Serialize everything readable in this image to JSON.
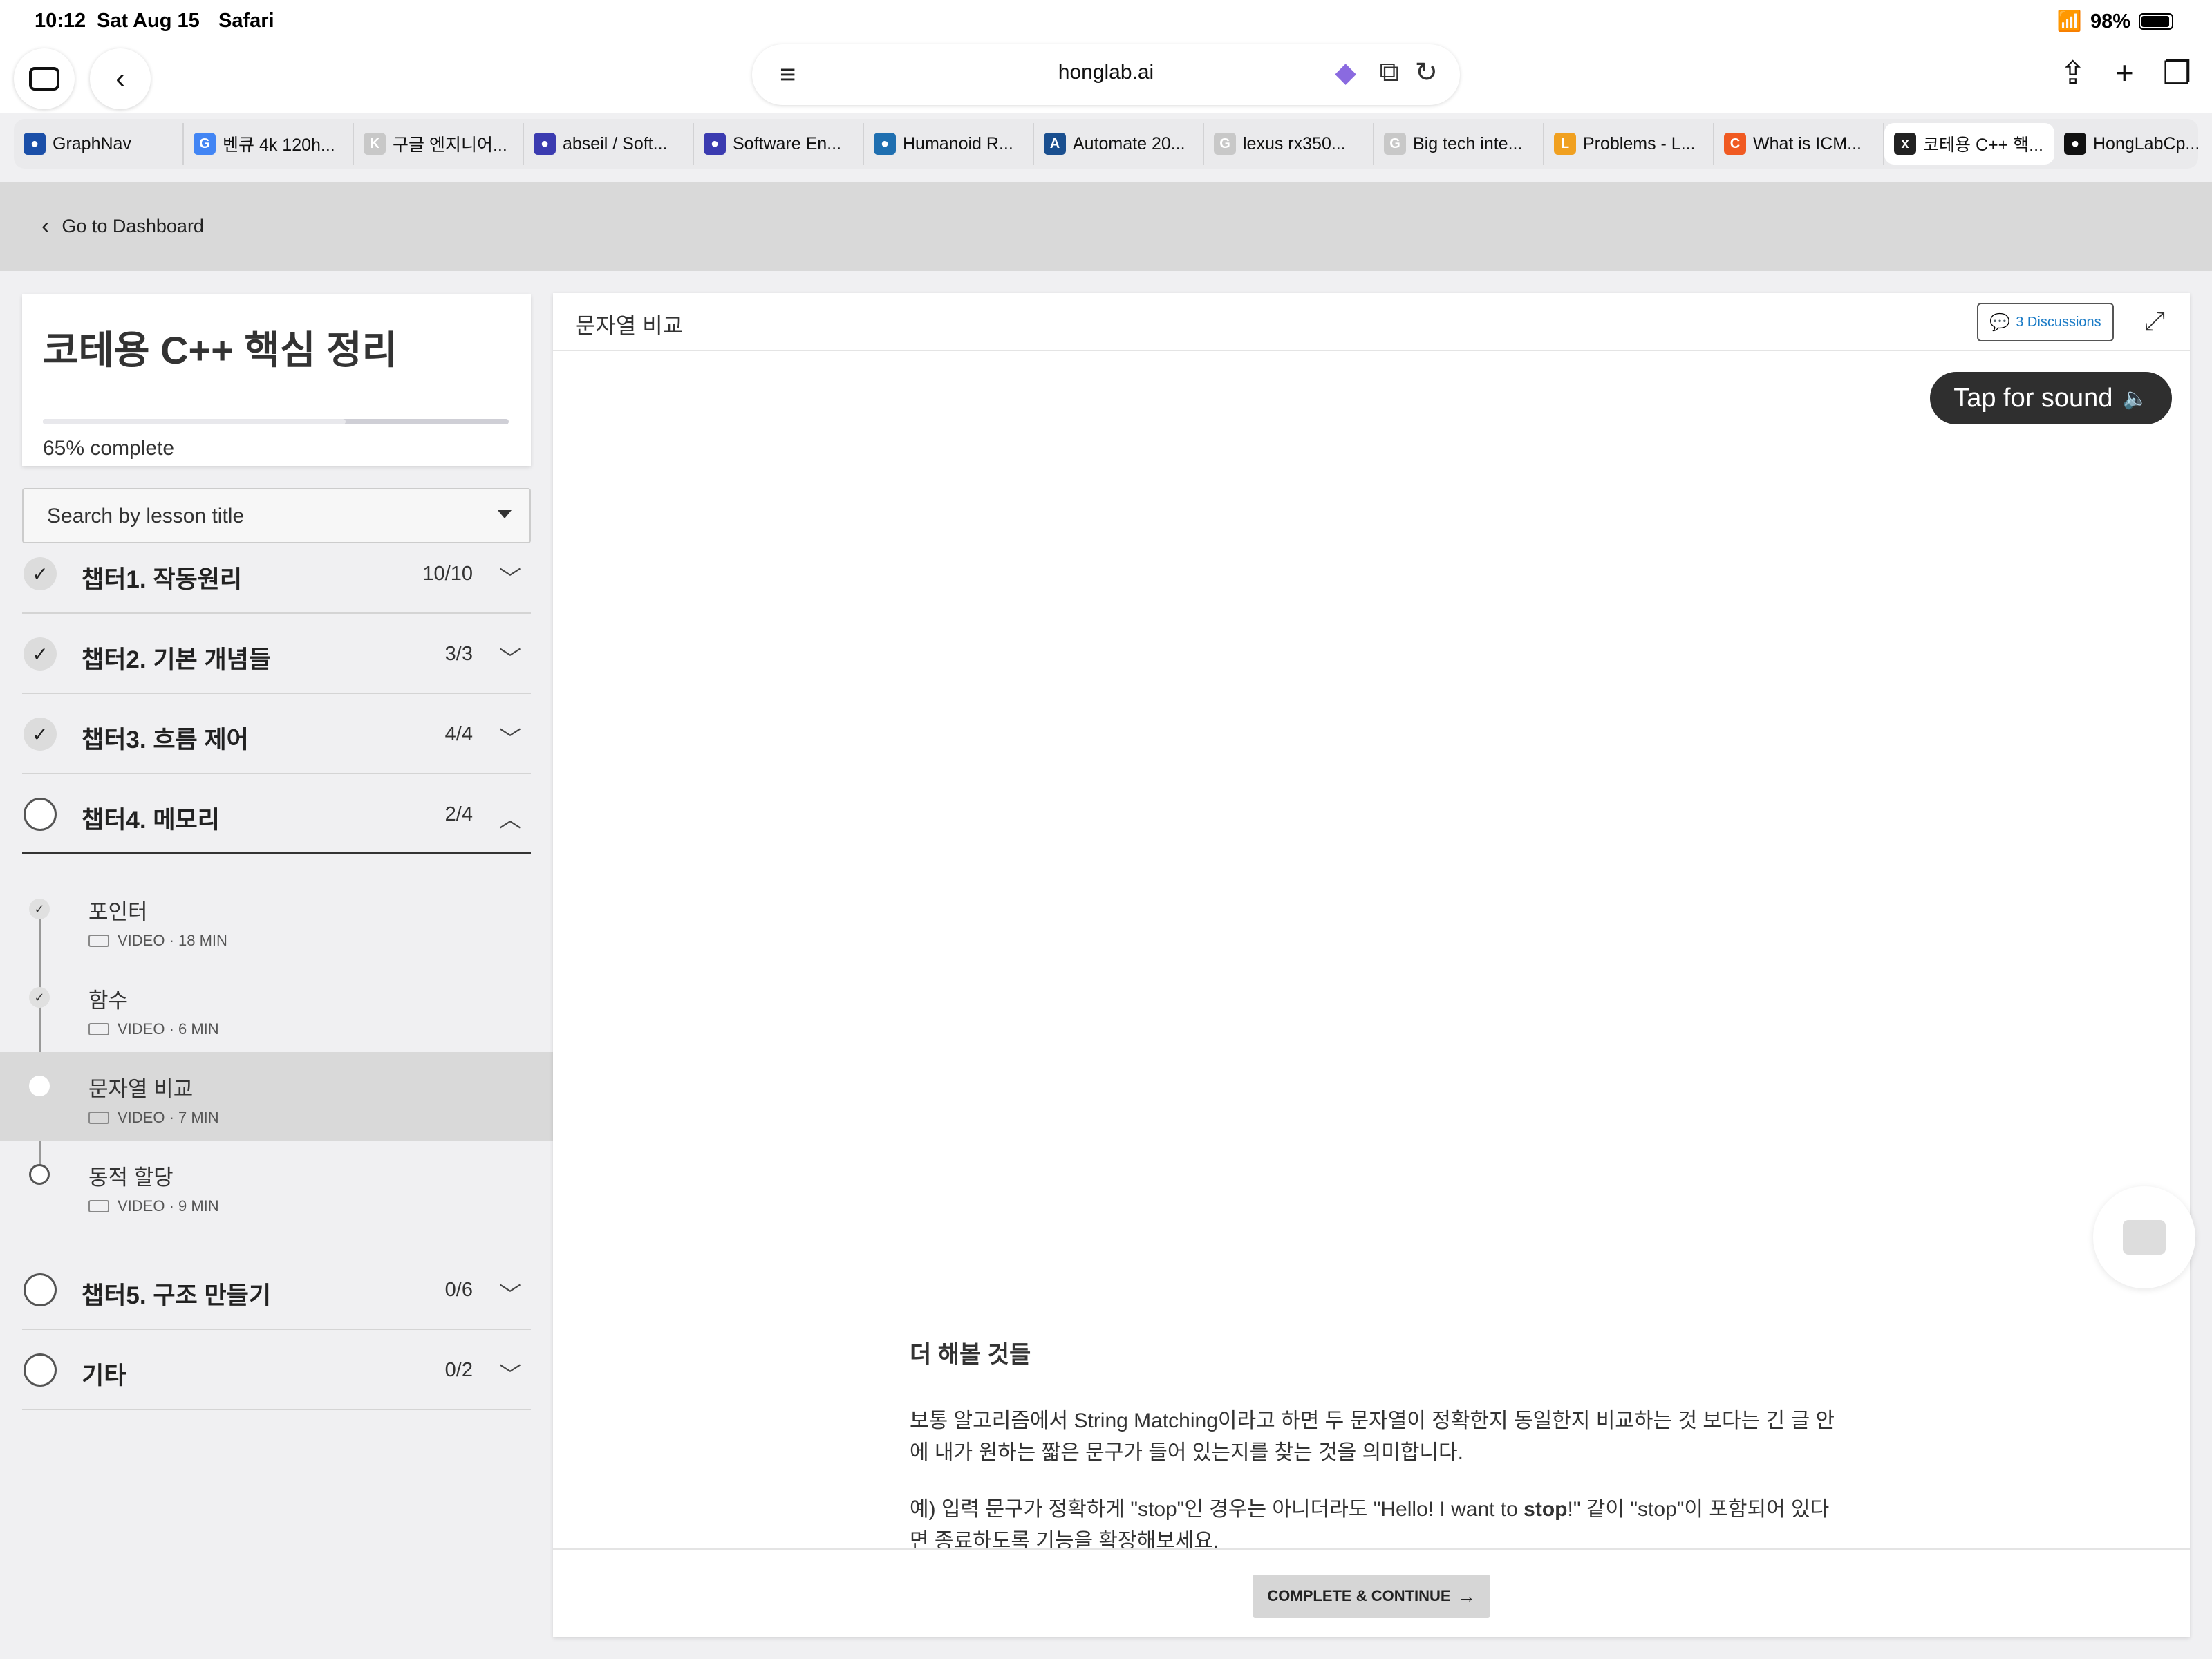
{
  "status": {
    "time": "10:12",
    "date": "Sat Aug 15",
    "app": "Safari",
    "battery": "98%"
  },
  "browser": {
    "url": "honglab.ai",
    "tabs": [
      {
        "label": "GraphNav",
        "icon": "graphnav",
        "color": "#1b4fa8"
      },
      {
        "label": "벤큐 4k 120h...",
        "icon": "G",
        "color": "#4285f4"
      },
      {
        "label": "구글 엔지니어...",
        "icon": "K",
        "color": "#c8c8c8"
      },
      {
        "label": "abseil / Soft...",
        "icon": "pentagon",
        "color": "#3b3bb0"
      },
      {
        "label": "Software En...",
        "icon": "pentagon",
        "color": "#3b3bb0"
      },
      {
        "label": "Humanoid R...",
        "icon": "globe",
        "color": "#1f6fb0"
      },
      {
        "label": "Automate 20...",
        "icon": "A",
        "color": "#1a4f8f"
      },
      {
        "label": "lexus rx350...",
        "icon": "G",
        "color": "#c8c8c8"
      },
      {
        "label": "Big tech inte...",
        "icon": "G",
        "color": "#c8c8c8"
      },
      {
        "label": "Problems - L...",
        "icon": "L",
        "color": "#f0a020"
      },
      {
        "label": "What is ICM...",
        "icon": "C",
        "color": "#f05a22"
      },
      {
        "label": "코테용 C++ 핵...",
        "icon": "x",
        "color": "#222"
      },
      {
        "label": "HongLabCp...",
        "icon": "github",
        "color": "#111"
      }
    ]
  },
  "site": {
    "back_label": "Go to Dashboard"
  },
  "course": {
    "title": "코테용 C++ 핵심 정리",
    "progress_pct": 65,
    "progress_text": "65% complete",
    "search_placeholder": "Search by lesson title"
  },
  "chapters": [
    {
      "name": "챕터1. 작동원리",
      "count": "10/10",
      "done": true
    },
    {
      "name": "챕터2. 기본 개념들",
      "count": "3/3",
      "done": true
    },
    {
      "name": "챕터3. 흐름 제어",
      "count": "4/4",
      "done": true
    },
    {
      "name": "챕터4. 메모리",
      "count": "2/4",
      "done": false
    },
    {
      "name": "챕터5. 구조 만들기",
      "count": "0/6",
      "done": false
    },
    {
      "name": "기타",
      "count": "0/2",
      "done": false
    }
  ],
  "lessons": [
    {
      "title": "포인터",
      "meta": "VIDEO · 18 MIN",
      "state": "done"
    },
    {
      "title": "함수",
      "meta": "VIDEO · 6 MIN",
      "state": "done"
    },
    {
      "title": "문자열 비교",
      "meta": "VIDEO · 7 MIN",
      "state": "current"
    },
    {
      "title": "동적 할당",
      "meta": "VIDEO · 9 MIN",
      "state": "todo"
    }
  ],
  "lesson_view": {
    "title": "문자열 비교",
    "discussions": "3 Discussions",
    "sound_label": "Tap for sound",
    "heading": "더 해볼 것들",
    "para1": "보통 알고리즘에서 String Matching이라고 하면 두 문자열이 정확한지 동일한지 비교하는 것 보다는 긴 글 안에 내가 원하는 짧은 문구가 들어 있는지를 찾는 것을 의미합니다.",
    "para2_a": "예) 입력 문구가 정확하게 \"stop\"인 경우는 아니더라도 \"Hello! I want to ",
    "para2_b": "stop",
    "para2_c": "!\" 같이 \"stop\"이 포함되어 있다면 종료하도록 기능을 확장해보세요.",
    "cta": "COMPLETE & CONTINUE"
  }
}
